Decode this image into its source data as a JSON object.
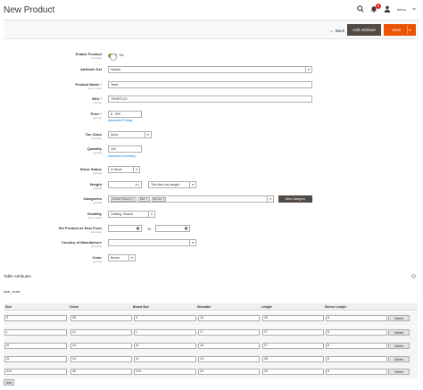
{
  "header": {
    "title": "New Product",
    "notification_count": "9",
    "user_label": "demo",
    "icons": [
      "search-icon",
      "bell-icon",
      "user-icon",
      "chevron-down-icon"
    ]
  },
  "actions": {
    "back_label": "Back",
    "add_attribute_label": "Add Attribute",
    "save_label": "Save"
  },
  "form": {
    "enable_product": {
      "label": "Enable Product",
      "scope": "[website]",
      "value": "Yes"
    },
    "attribute_set": {
      "label": "Attribute Set",
      "value": "Default"
    },
    "product_name": {
      "label": "Product Name",
      "scope": "[store view]",
      "value": "Tshirt"
    },
    "sku": {
      "label": "SKU",
      "scope": "[global]",
      "value": "TSHIRT123"
    },
    "price": {
      "label": "Price",
      "scope": "[global]",
      "currency": "$",
      "value": "999",
      "link": "Advanced Pricing"
    },
    "tax_class": {
      "label": "Tax Class",
      "scope": "[website]",
      "value": "None"
    },
    "quantity": {
      "label": "Quantity",
      "scope": "[global]",
      "value": "100",
      "link": "Advanced Inventory"
    },
    "stock_status": {
      "label": "Stock Status",
      "scope": "[global]",
      "value": "In Stock"
    },
    "weight": {
      "label": "Weight",
      "scope": "[global]",
      "unit": "lbs",
      "value": "",
      "has_weight": "This item has weight"
    },
    "categories": {
      "label": "Categories",
      "scope": "[global]",
      "tags": [
        "Default Category",
        "Men",
        "Women"
      ],
      "new_button": "New Category"
    },
    "visibility": {
      "label": "Visibility",
      "scope": "[store view]",
      "value": "Catalog, Search"
    },
    "set_new": {
      "label": "Set Product as New From",
      "scope": "[website]",
      "to_label": "To"
    },
    "country": {
      "label": "Country of Manufacture",
      "scope": "[website]",
      "value": ""
    },
    "color": {
      "label": "Color",
      "scope": "[global]",
      "value": "Brown"
    }
  },
  "table_attributes": {
    "section_title": "Table Attributes",
    "help": "?",
    "attribute_name": "size_chart",
    "columns": [
      "Size",
      "Chest",
      "Brand Size",
      "Shoulder",
      "Length",
      "Sleeve Length"
    ],
    "rows": [
      [
        "S",
        "38",
        "S",
        "16",
        "26",
        "8"
      ],
      [
        "L",
        "41",
        "L",
        "17",
        "27",
        "8"
      ],
      [
        "M",
        "43",
        "M",
        "18",
        "27",
        "8"
      ],
      [
        "XL",
        "44",
        "XL",
        "19",
        "28",
        "8"
      ],
      [
        "XXL",
        "46",
        "XXL",
        "20",
        "29",
        "8"
      ]
    ],
    "delete_label": "Delete",
    "add_label": "Add"
  }
}
